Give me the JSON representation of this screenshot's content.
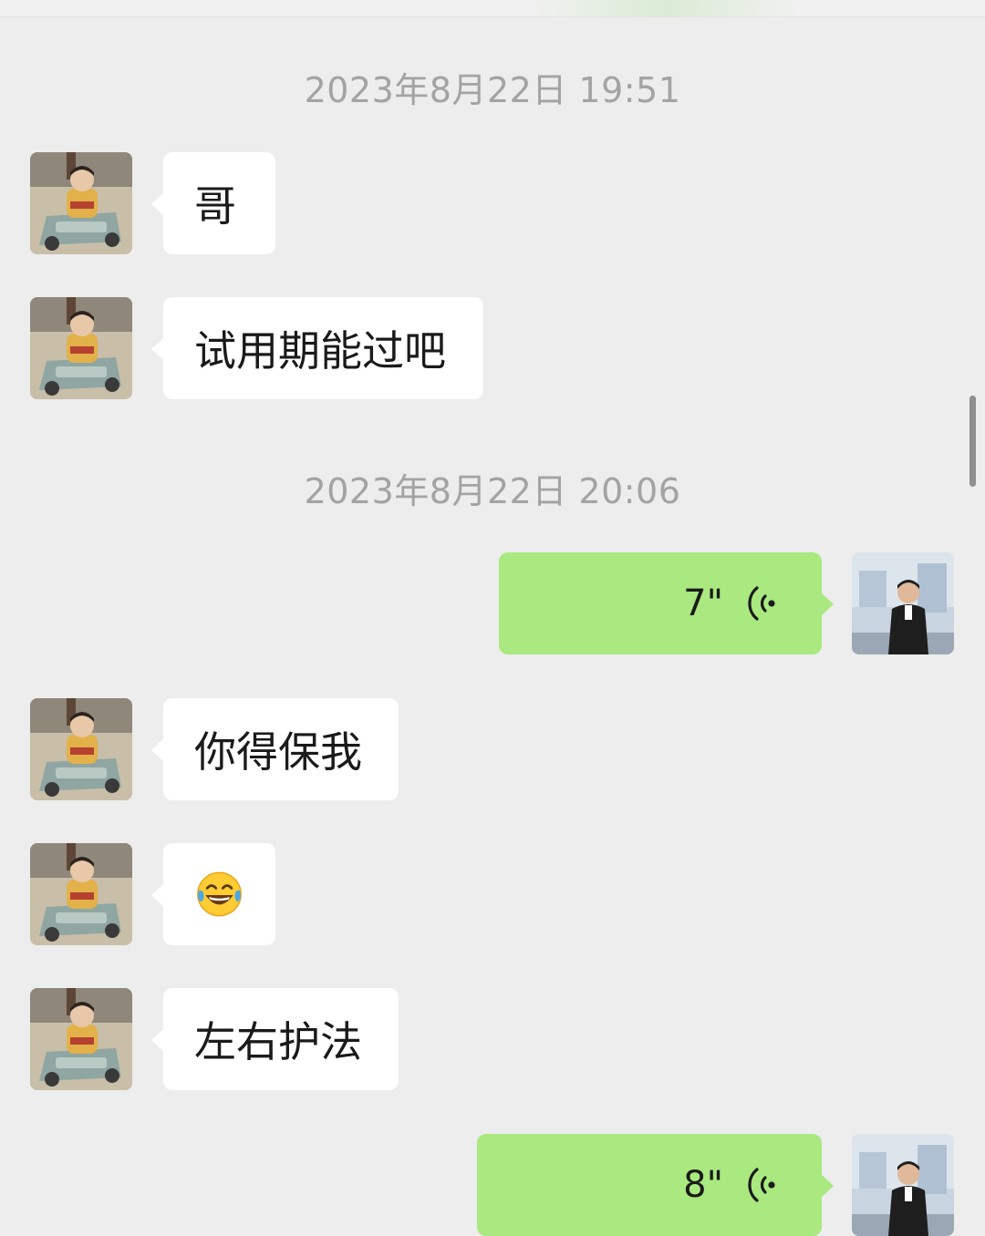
{
  "chat": {
    "timestamps": [
      "2023年8月22日 19:51",
      "2023年8月22日 20:06"
    ],
    "messages": [
      {
        "text": "哥"
      },
      {
        "text": "试用期能过吧"
      },
      {
        "duration": "7\""
      },
      {
        "text": "你得保我"
      },
      {
        "emoji": "tears-of-joy-emoji"
      },
      {
        "text": "左右护法"
      },
      {
        "duration": "8\""
      }
    ]
  },
  "colors": {
    "background": "#EDEDED",
    "incoming_bubble": "#FFFFFF",
    "outgoing_bubble": "#A9E97F",
    "timestamp_text": "#A3A3A3"
  }
}
